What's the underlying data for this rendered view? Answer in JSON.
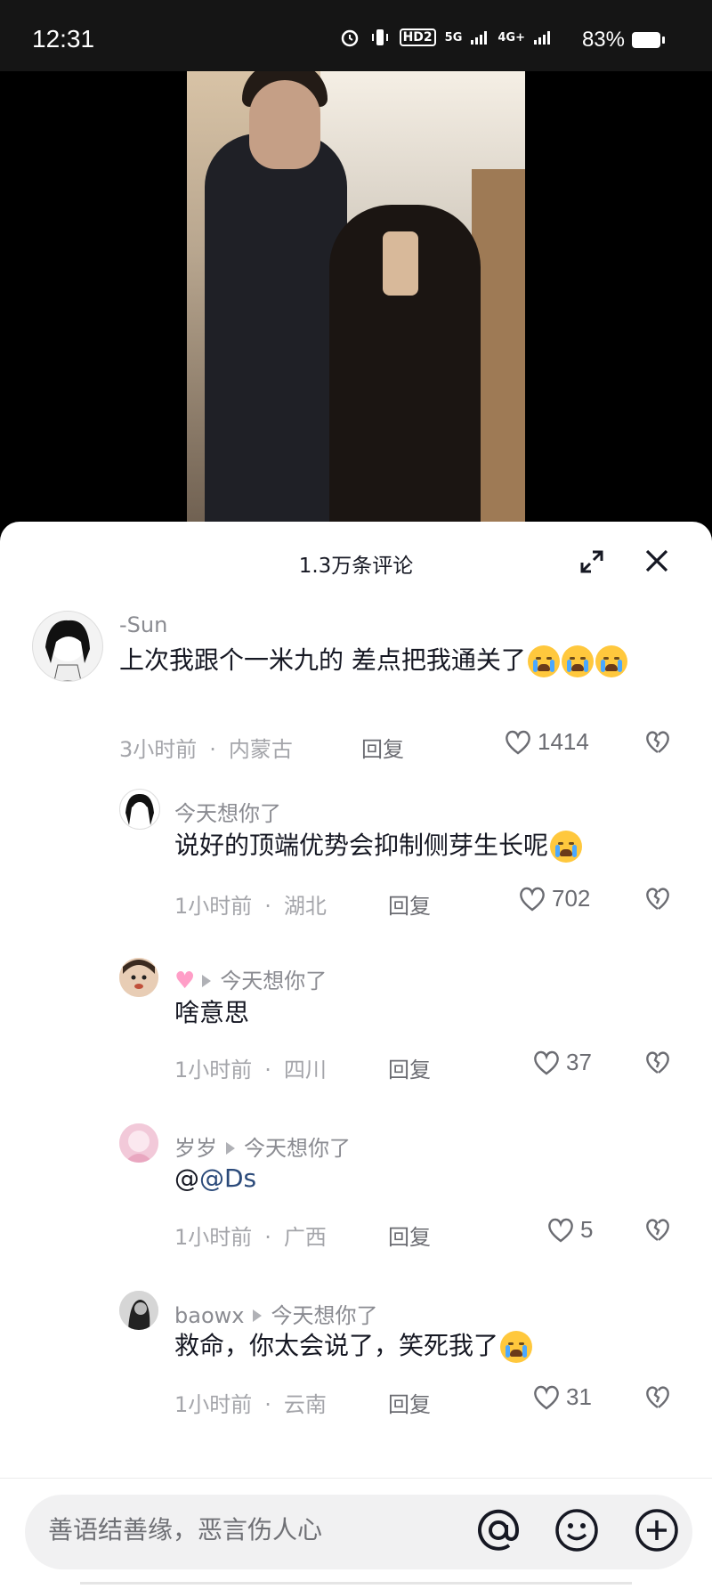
{
  "status_bar": {
    "time": "12:31",
    "battery": "83%",
    "network": "4G+",
    "network2": "5G",
    "hd": "HD2"
  },
  "sheet": {
    "title": "1.3万条评论"
  },
  "comments": [
    {
      "user": "-Sun",
      "text": "上次我跟个一米九的 差点把我通关了",
      "time": "3小时前",
      "location": "内蒙古",
      "reply": "回复",
      "likes": "1414"
    },
    {
      "user": "今天想你了",
      "text": "说好的顶端优势会抑制侧芽生长呢",
      "time": "1小时前",
      "location": "湖北",
      "reply": "回复",
      "likes": "702"
    },
    {
      "user": "",
      "reply_to": "今天想你了",
      "text": "啥意思",
      "time": "1小时前",
      "location": "四川",
      "reply": "回复",
      "likes": "37"
    },
    {
      "user": "岁岁",
      "reply_to": "今天想你了",
      "text_prefix": "@",
      "mention": "@Ds",
      "time": "1小时前",
      "location": "广西",
      "reply": "回复",
      "likes": "5"
    },
    {
      "user": "baowx",
      "reply_to": "今天想你了",
      "text": "救命，你太会说了，笑死我了",
      "time": "1小时前",
      "location": "云南",
      "reply": "回复",
      "likes": "31"
    }
  ],
  "input": {
    "placeholder": "善语结善缘，恶言伤人心"
  },
  "icons": {
    "expand": "expand-icon",
    "close": "close-icon",
    "heart": "heart-icon",
    "dislike": "broken-heart-icon",
    "at": "at-icon",
    "emoji": "smile-icon",
    "add": "plus-icon"
  }
}
